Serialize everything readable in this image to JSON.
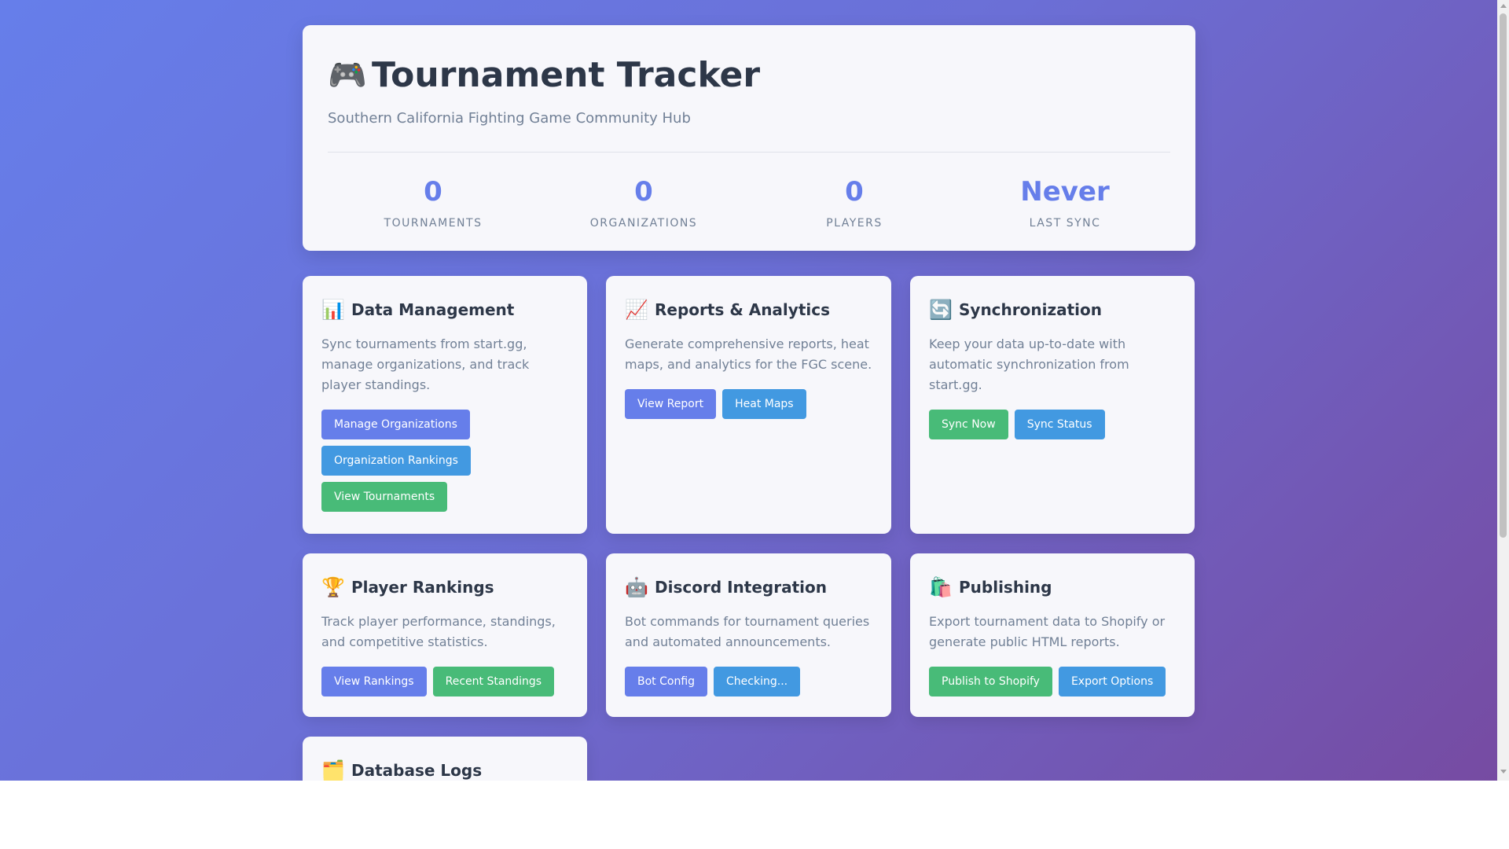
{
  "header": {
    "icon": "game-controller-icon",
    "icon_glyph": "🎮",
    "title": "Tournament Tracker",
    "subtitle": "Southern California Fighting Game Community Hub"
  },
  "stats": [
    {
      "value": "0",
      "label": "TOURNAMENTS"
    },
    {
      "value": "0",
      "label": "ORGANIZATIONS"
    },
    {
      "value": "0",
      "label": "PLAYERS"
    },
    {
      "value": "Never",
      "label": "LAST SYNC"
    }
  ],
  "cards": {
    "data_management": {
      "icon": "bar-chart-icon",
      "icon_glyph": "📊",
      "title": "Data Management",
      "description": "Sync tournaments from start.gg, manage organizations, and track player standings.",
      "buttons": [
        "Manage Organizations",
        "Organization Rankings",
        "View Tournaments"
      ]
    },
    "reports": {
      "icon": "trend-chart-icon",
      "icon_glyph": "📈",
      "title": "Reports & Analytics",
      "description": "Generate comprehensive reports, heat maps, and analytics for the FGC scene.",
      "buttons": [
        "View Report",
        "Heat Maps"
      ]
    },
    "sync": {
      "icon": "sync-arrows-icon",
      "icon_glyph": "🔄",
      "title": "Synchronization",
      "description": "Keep your data up-to-date with automatic synchronization from start.gg.",
      "buttons": [
        "Sync Now",
        "Sync Status"
      ]
    },
    "player_rankings": {
      "icon": "trophy-icon",
      "icon_glyph": "🏆",
      "title": "Player Rankings",
      "description": "Track player performance, standings, and competitive statistics.",
      "buttons": [
        "View Rankings",
        "Recent Standings"
      ]
    },
    "discord": {
      "icon": "robot-icon",
      "icon_glyph": "🤖",
      "title": "Discord Integration",
      "description": "Bot commands for tournament queries and automated announcements.",
      "buttons": [
        "Bot Config",
        "Checking..."
      ]
    },
    "publishing": {
      "icon": "shopping-bags-icon",
      "icon_glyph": "🛍️",
      "title": "Publishing",
      "description": "Export tournament data to Shopify or generate public HTML reports.",
      "buttons": [
        "Publish to Shopify",
        "Export Options"
      ]
    },
    "database_logs": {
      "icon": "card-index-dividers-icon",
      "icon_glyph": "🗂️",
      "title": "Database Logs"
    }
  },
  "colors": {
    "accent": "#667eea",
    "info": "#4299e1",
    "success": "#48bb78",
    "gradient_start": "#667eea",
    "gradient_end": "#764ba2"
  }
}
